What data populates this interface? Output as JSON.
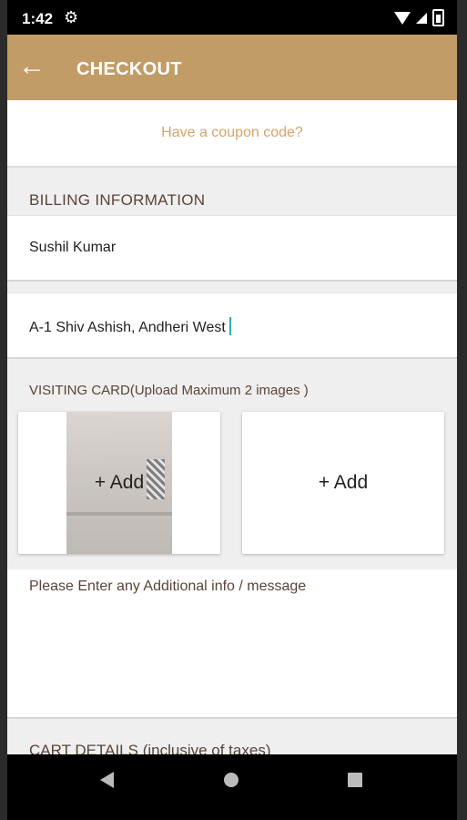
{
  "status_bar": {
    "time": "1:42"
  },
  "app_bar": {
    "title": "CHECKOUT"
  },
  "coupon": {
    "label": "Have a coupon code?"
  },
  "billing": {
    "heading": "BILLING INFORMATION",
    "name_value": "Sushil Kumar",
    "address_value": "A-1 Shiv Ashish, Andheri West"
  },
  "visiting_card": {
    "label": "VISITING CARD(Upload Maximum 2 images )",
    "slots": [
      {
        "add_label": "+ Add"
      },
      {
        "add_label": "+ Add"
      }
    ]
  },
  "additional_info": {
    "placeholder": "Please Enter any Additional info / message"
  },
  "cart": {
    "heading": "CART DETAILS (inclusive of taxes)"
  },
  "colors": {
    "appbar": "#c19c67",
    "coupon_text": "#d9a26a",
    "caret": "#25b4b4"
  }
}
